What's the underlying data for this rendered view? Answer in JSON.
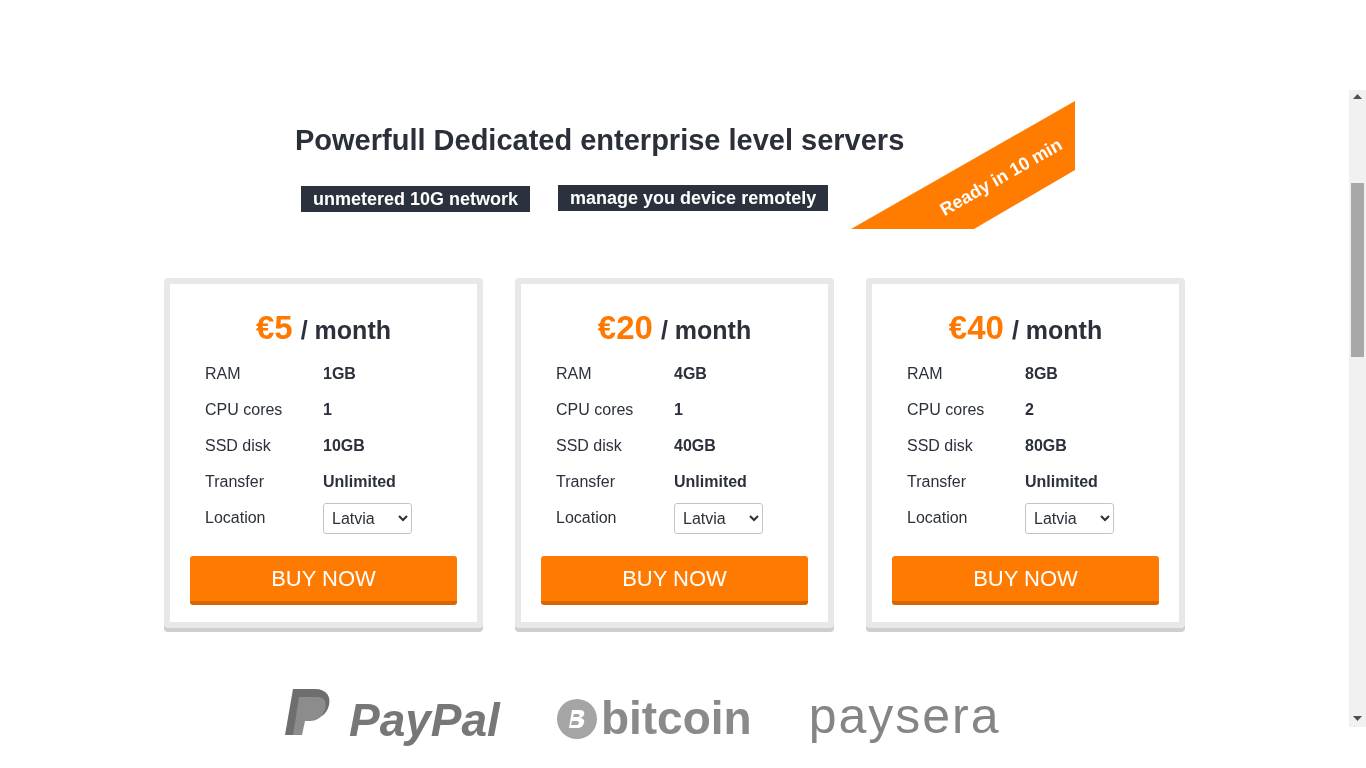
{
  "heading": "Powerfull Dedicated enterprise level servers",
  "features": [
    "unmetered 10G network",
    "manage you device remotely"
  ],
  "ribbon": "Ready in 10 min",
  "plans": [
    {
      "price": "€5",
      "period": "/ month",
      "specs": [
        {
          "kind": "text",
          "label": "RAM",
          "value": "1GB"
        },
        {
          "kind": "text",
          "label": "CPU cores",
          "value": "1"
        },
        {
          "kind": "text",
          "label": "SSD disk",
          "value": "10GB"
        },
        {
          "kind": "text",
          "label": "Transfer",
          "value": "Unlimited"
        },
        {
          "kind": "select",
          "label": "Location",
          "value": "Latvia"
        }
      ],
      "button": "BUY NOW"
    },
    {
      "price": "€20",
      "period": "/ month",
      "specs": [
        {
          "kind": "text",
          "label": "RAM",
          "value": "4GB"
        },
        {
          "kind": "text",
          "label": "CPU cores",
          "value": "1"
        },
        {
          "kind": "text",
          "label": "SSD disk",
          "value": "40GB"
        },
        {
          "kind": "text",
          "label": "Transfer",
          "value": "Unlimited"
        },
        {
          "kind": "select",
          "label": "Location",
          "value": "Latvia"
        }
      ],
      "button": "BUY NOW"
    },
    {
      "price": "€40",
      "period": "/ month",
      "specs": [
        {
          "kind": "text",
          "label": "RAM",
          "value": "8GB"
        },
        {
          "kind": "text",
          "label": "CPU cores",
          "value": "2"
        },
        {
          "kind": "text",
          "label": "SSD disk",
          "value": "80GB"
        },
        {
          "kind": "text",
          "label": "Transfer",
          "value": "Unlimited"
        },
        {
          "kind": "select",
          "label": "Location",
          "value": "Latvia"
        }
      ],
      "button": "BUY NOW"
    }
  ],
  "payment_logos": [
    {
      "kind": "paypal",
      "name": "PayPal"
    },
    {
      "kind": "bitcoin",
      "name": "bitcoin"
    },
    {
      "kind": "paysera",
      "name": "paysera"
    }
  ]
}
